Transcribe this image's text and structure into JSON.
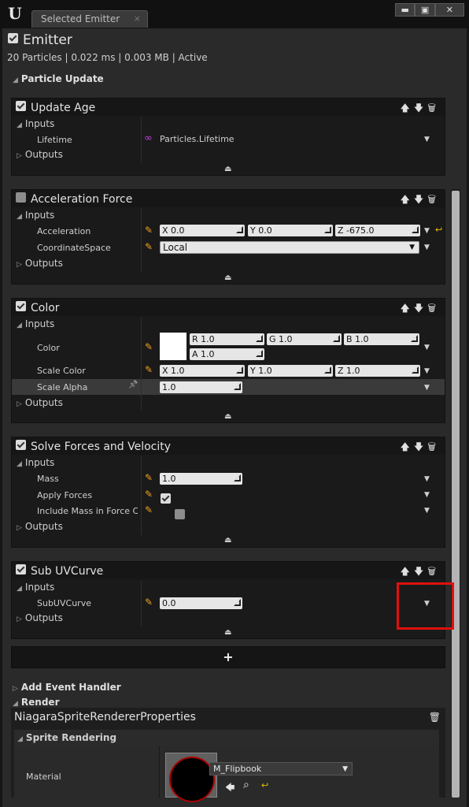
{
  "window": {
    "logo": "U",
    "tab_title": "Selected Emitter",
    "tab_close": "×",
    "buttons": {
      "minimize": "▬",
      "maximize": "▣",
      "close": "✕"
    }
  },
  "emitter": {
    "title": "Emitter",
    "stats": "20 Particles | 0.022 ms | 0.003 MB | Active",
    "enabled": true
  },
  "sections": {
    "particle_update": "Particle Update",
    "add_event_handler": "Add Event Handler",
    "render": "Render"
  },
  "common": {
    "inputs": "Inputs",
    "outputs": "Outputs",
    "expanded_arrow": "◢",
    "collapsed_arrow": "▷",
    "dropdown": "▼",
    "collapse_glyph": "⏏",
    "pencil": "✎",
    "pin": "📌",
    "reset": "↩",
    "module_icons": "🡅🡇🗑",
    "add": "+"
  },
  "modules": {
    "update_age": {
      "title": "Update Age",
      "enabled": true,
      "lifetime_label": "Lifetime",
      "lifetime_value": "Particles.Lifetime",
      "link_icon": "∞"
    },
    "acceleration_force": {
      "title": "Acceleration Force",
      "enabled": false,
      "acceleration_label": "Acceleration",
      "x": "X 0.0",
      "y": "Y 0.0",
      "z": "Z -675.0",
      "coordinate_label": "CoordinateSpace",
      "coordinate_value": "Local"
    },
    "color": {
      "title": "Color",
      "enabled": true,
      "color_label": "Color",
      "r": "R 1.0",
      "g": "G 1.0",
      "b": "B 1.0",
      "a": "A 1.0",
      "scale_color_label": "Scale Color",
      "sx": "X 1.0",
      "sy": "Y 1.0",
      "sz": "Z 1.0",
      "scale_alpha_label": "Scale Alpha",
      "scale_alpha_value": "1.0",
      "swatch_color": "#ffffff"
    },
    "solve_forces": {
      "title": "Solve Forces and Velocity",
      "enabled": true,
      "mass_label": "Mass",
      "mass_value": "1.0",
      "apply_forces_label": "Apply Forces",
      "apply_forces_checked": true,
      "include_mass_label": "Include Mass in Force C",
      "include_mass_checked": false
    },
    "sub_uv_curve": {
      "title": "Sub UVCurve",
      "enabled": true,
      "subuv_label": "SubUVCurve",
      "subuv_value": "0.0"
    }
  },
  "renderer": {
    "title": "NiagaraSpriteRendererProperties",
    "sprite_rendering": "Sprite Rendering",
    "material_label": "Material",
    "material_value": "M_Flipbook",
    "material_actions": {
      "use": "🡄",
      "browse": "⌕",
      "reset": "↩"
    }
  },
  "colors": {
    "highlight": "#e01010",
    "pencil": "#f0a020",
    "link": "#c040e0"
  }
}
